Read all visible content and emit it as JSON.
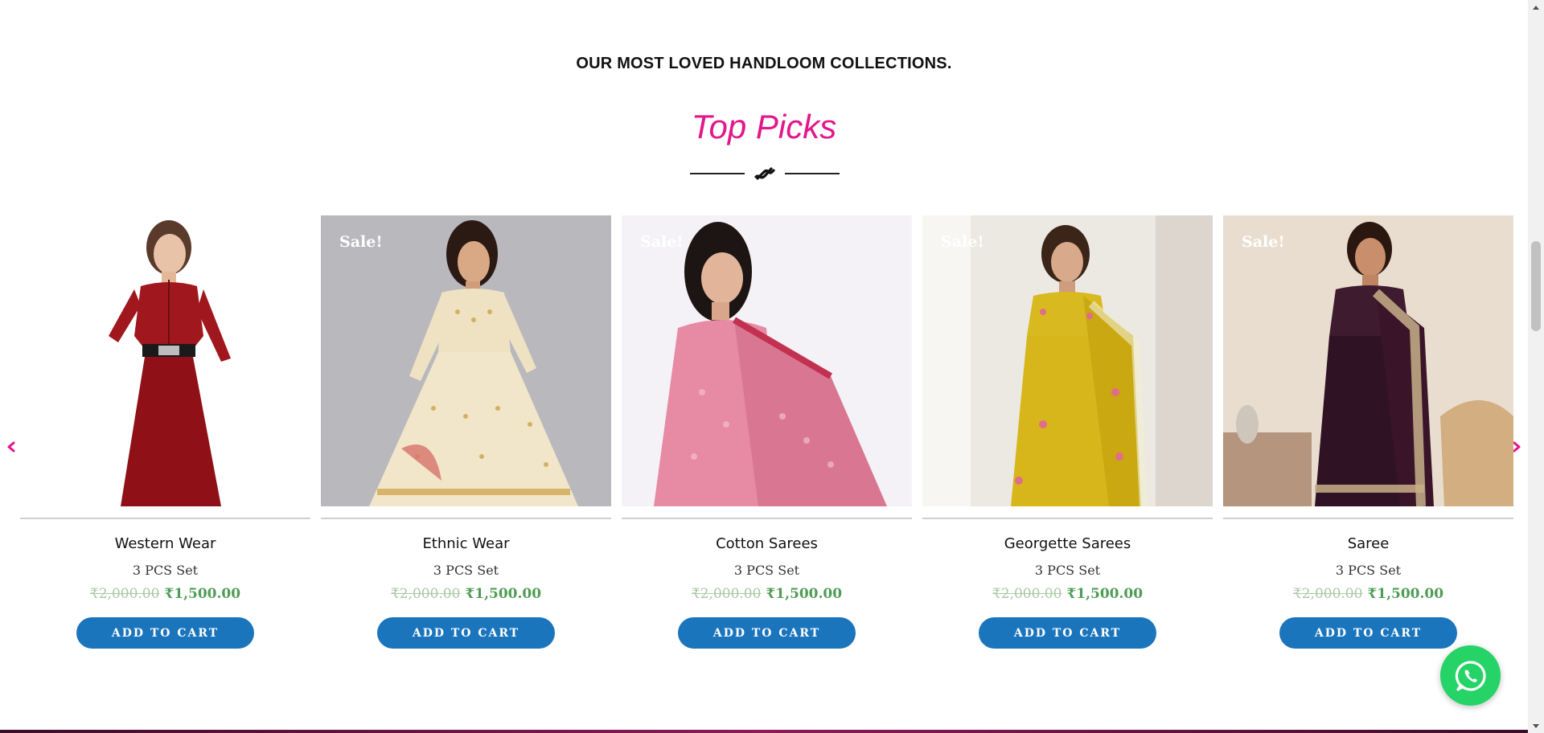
{
  "section": {
    "eyebrow": "OUR MOST LOVED HANDLOOM COLLECTIONS.",
    "title": "Top Picks"
  },
  "colors": {
    "accent_pink": "#e3168a",
    "button_blue": "#1b75bc",
    "price_green": "#4f9c56",
    "whatsapp_green": "#25d366"
  },
  "carousel": {
    "prev_icon": "chevron-left-icon",
    "next_icon": "chevron-right-icon"
  },
  "products": [
    {
      "name": "Western Wear",
      "subtitle": "3 PCS Set",
      "old_price": "₹2,000.00",
      "price": "₹1,500.00",
      "button": "ADD TO CART",
      "sale": ""
    },
    {
      "name": "Ethnic Wear",
      "subtitle": "3 PCS Set",
      "old_price": "₹2,000.00",
      "price": "₹1,500.00",
      "button": "ADD TO CART",
      "sale": "Sale!"
    },
    {
      "name": "Cotton Sarees",
      "subtitle": "3 PCS Set",
      "old_price": "₹2,000.00",
      "price": "₹1,500.00",
      "button": "ADD TO CART",
      "sale": "Sale!"
    },
    {
      "name": "Georgette Sarees",
      "subtitle": "3 PCS Set",
      "old_price": "₹2,000.00",
      "price": "₹1,500.00",
      "button": "ADD TO CART",
      "sale": "Sale!"
    },
    {
      "name": "Saree",
      "subtitle": "3 PCS Set",
      "old_price": "₹2,000.00",
      "price": "₹1,500.00",
      "button": "ADD TO CART",
      "sale": "Sale!"
    }
  ],
  "whatsapp": {
    "icon": "whatsapp-icon"
  }
}
